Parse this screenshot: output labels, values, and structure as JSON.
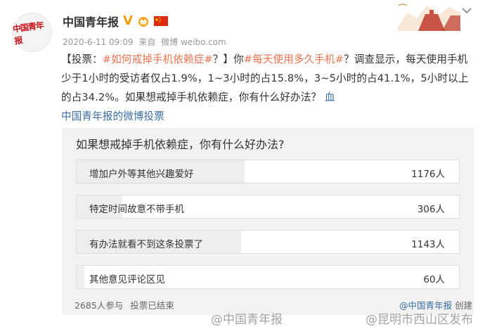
{
  "account": {
    "avatar_text": "中国青年报",
    "name": "中国青年报",
    "verified_mark": "V"
  },
  "meta": {
    "date": "2020-6-11 09:09",
    "source_prefix": "来自",
    "source": "微博 weibo.com"
  },
  "post": {
    "bracket_open": "【投票：",
    "topic1": "#如何戒掉手机依赖症#",
    "seg1": "？】你",
    "topic2": "#每天使用多久手机#",
    "seg2": "？调查显示，每天使用手机少于1小时的受访者仅占1.9%，1~3小时的占15.8%，3~5小时的占41.1%，5小时以上的占34.2%。如果想戒掉手机依赖症，你有什么好办法？",
    "vote_icon": "血",
    "vote_link": "中国青年报的微博投票"
  },
  "poll": {
    "title": "如果想戒掉手机依赖症，你有什么好办法?",
    "options": [
      {
        "label": "增加户外等其他兴趣爱好",
        "count": "1176人",
        "share": 0.44
      },
      {
        "label": "特定时间故意不带手机",
        "count": "306人",
        "share": 0.12
      },
      {
        "label": "有办法就看不到这条投票了",
        "count": "1143人",
        "share": 0.43
      },
      {
        "label": "其他意见评论区见",
        "count": "60人",
        "share": 0.02
      }
    ],
    "participants": "2685人参与",
    "status": "投票已结束",
    "creator_at": "@中国青年报",
    "creator_suffix": "创建"
  },
  "watermarks": {
    "left": "@中国青年报",
    "right": "@昆明市西山区发布"
  },
  "colors": {
    "topic": "#eb7350",
    "link": "#3a6ea5",
    "brand_red": "#c8161d",
    "verified": "#f39c12"
  }
}
